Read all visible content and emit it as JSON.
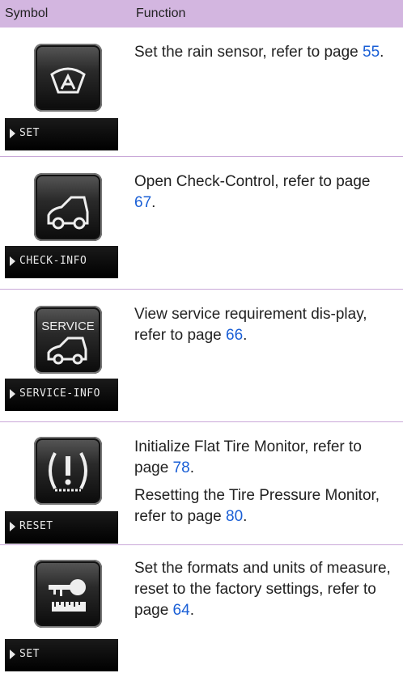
{
  "header": {
    "symbol": "Symbol",
    "function": "Function"
  },
  "rows": [
    {
      "icon": "rain-sensor-icon",
      "lcd_label": "SET",
      "text": "Set the rain sensor, refer to page ",
      "page": "55",
      "tail": "."
    },
    {
      "icon": "check-control-car-icon",
      "lcd_label": "CHECK-INFO",
      "text": "Open Check-Control, refer to page ",
      "page": "67",
      "tail": "."
    },
    {
      "icon": "service-car-icon",
      "icon_text": "SERVICE",
      "lcd_label": "SERVICE-INFO",
      "text": "View service requirement dis-play, refer to page ",
      "page": "66",
      "tail": "."
    },
    {
      "icon": "tire-pressure-warning-icon",
      "lcd_label": "RESET",
      "text": "Initialize Flat Tire Monitor, refer to page ",
      "page": "78",
      "tail": ".",
      "text2": "Resetting the Tire Pressure Monitor, refer to page ",
      "page2": "80",
      "tail2": "."
    },
    {
      "icon": "key-ruler-settings-icon",
      "lcd_label": "SET",
      "text": "Set the formats and units of measure, reset to the factory settings, refer to page ",
      "page": "64",
      "tail": "."
    }
  ]
}
